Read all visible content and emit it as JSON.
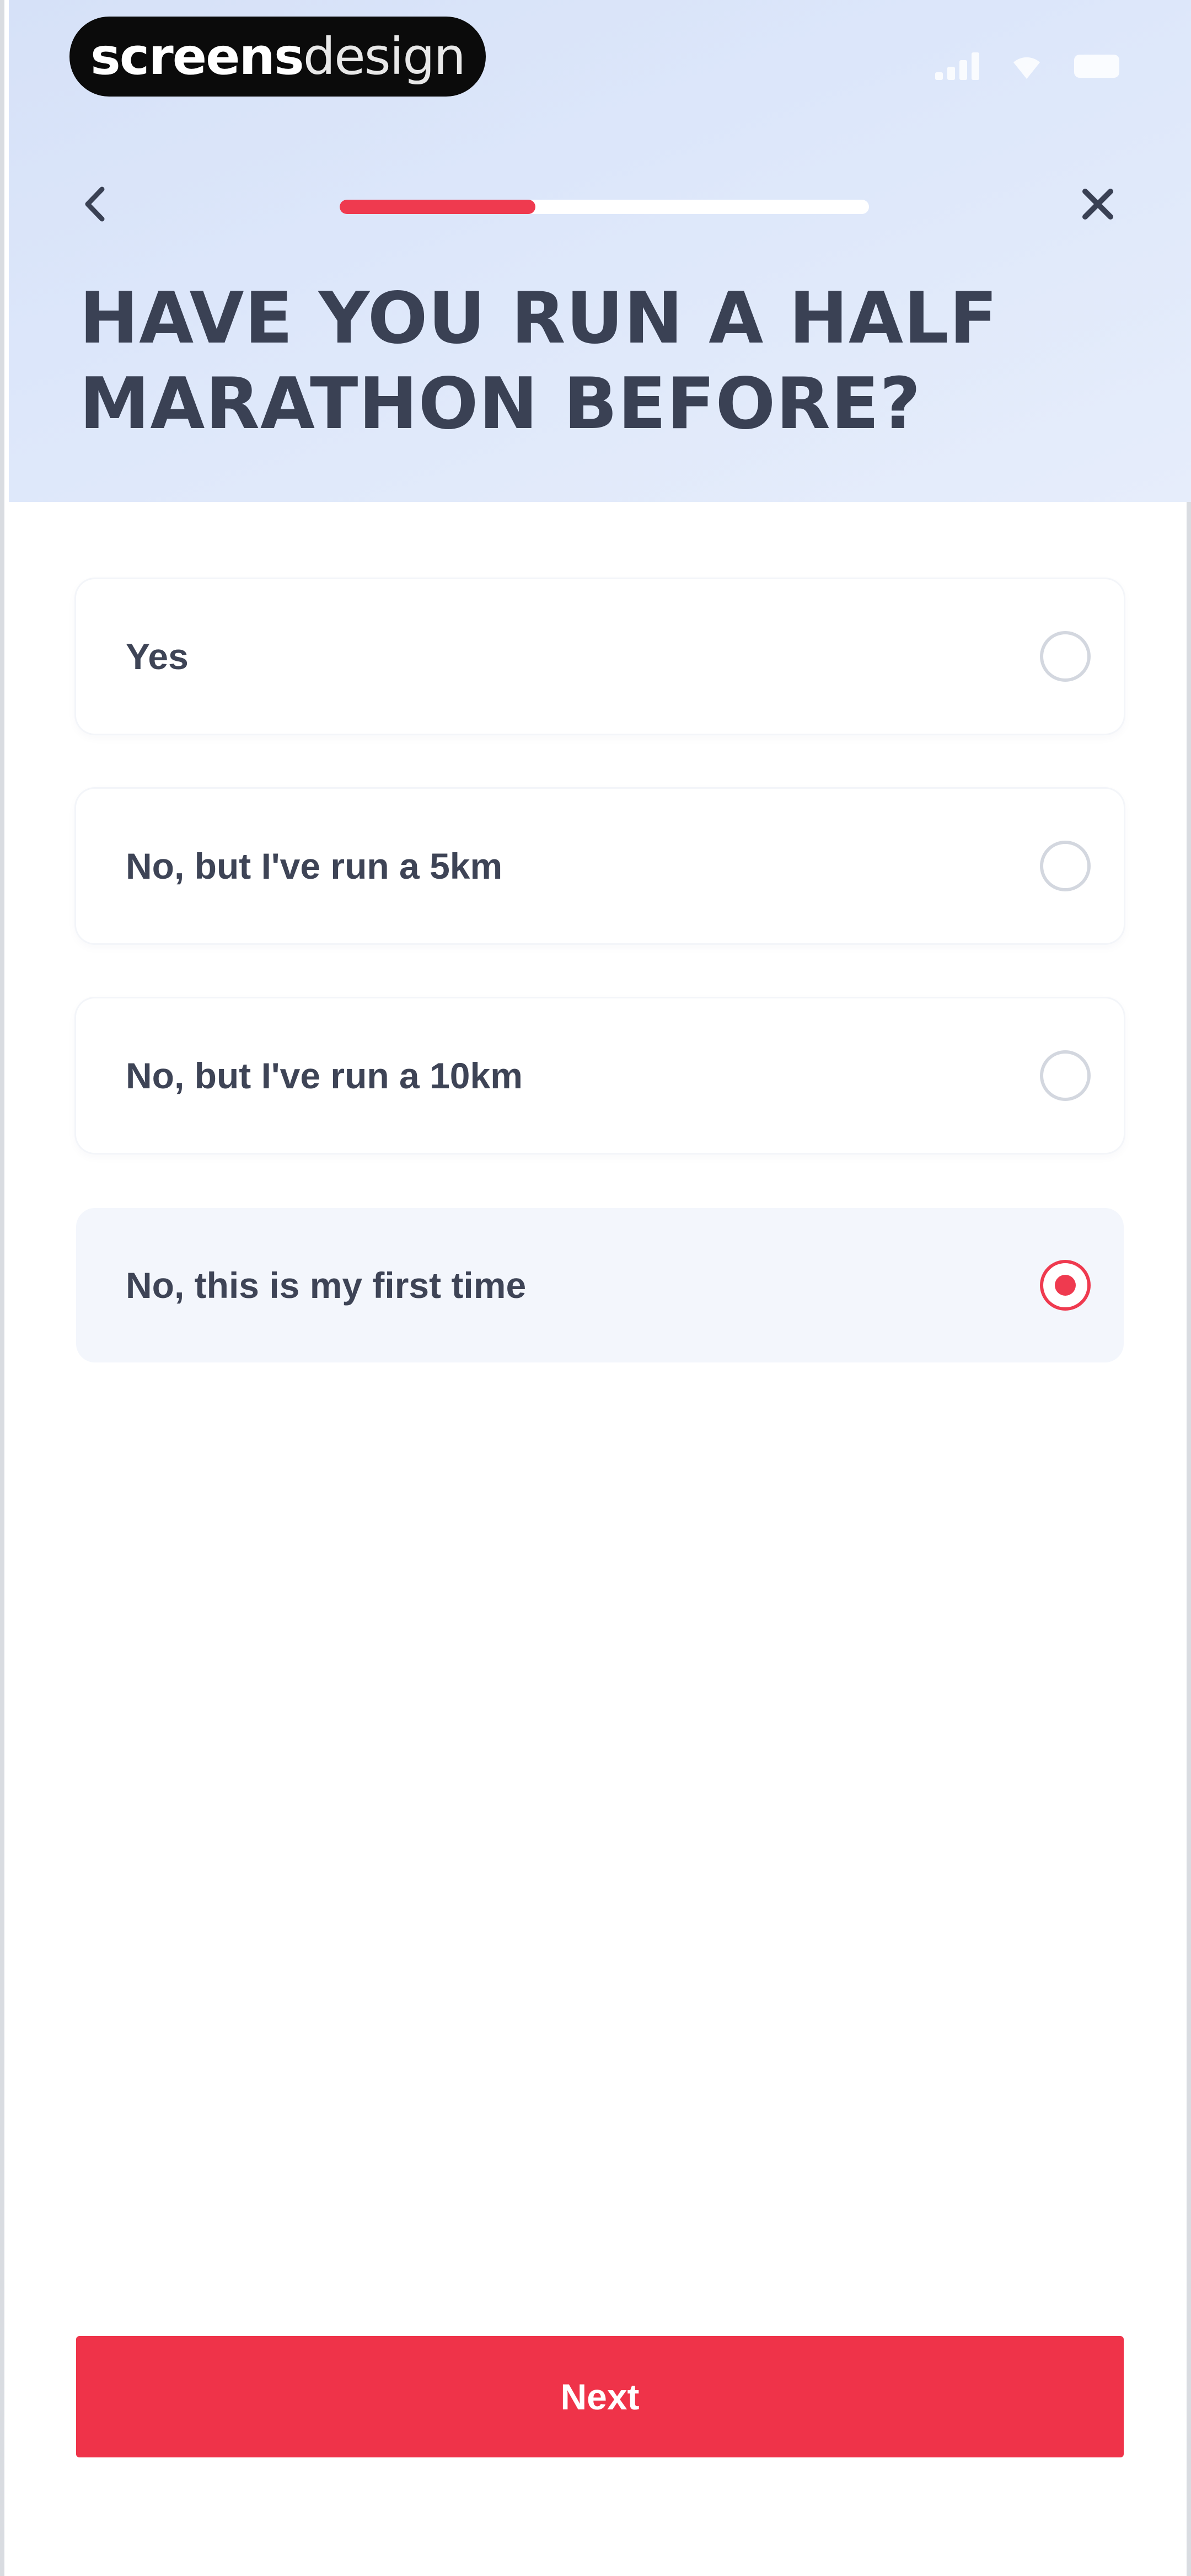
{
  "brand": {
    "name_bold": "screens",
    "name_light": "design"
  },
  "status_bar": {
    "icons": [
      "signal-icon",
      "wifi-icon",
      "battery-icon"
    ]
  },
  "nav": {
    "back_icon": "chevron-left-icon",
    "close_icon": "close-icon",
    "progress_fraction": 0.37
  },
  "question": {
    "title": "HAVE YOU RUN A HALF MARATHON BEFORE?"
  },
  "options": [
    {
      "label": "Yes",
      "selected": false
    },
    {
      "label": "No, but I've run a 5km",
      "selected": false
    },
    {
      "label": "No, but I've run a 10km",
      "selected": false
    },
    {
      "label": "No, this is my first time",
      "selected": true
    }
  ],
  "footer": {
    "next_label": "Next"
  },
  "colors": {
    "accent": "#ef3a4f",
    "header_bg": "#d9e4f9",
    "title_text": "#3a4154",
    "option_text": "#3e4456",
    "selected_bg": "#f3f6fc"
  }
}
